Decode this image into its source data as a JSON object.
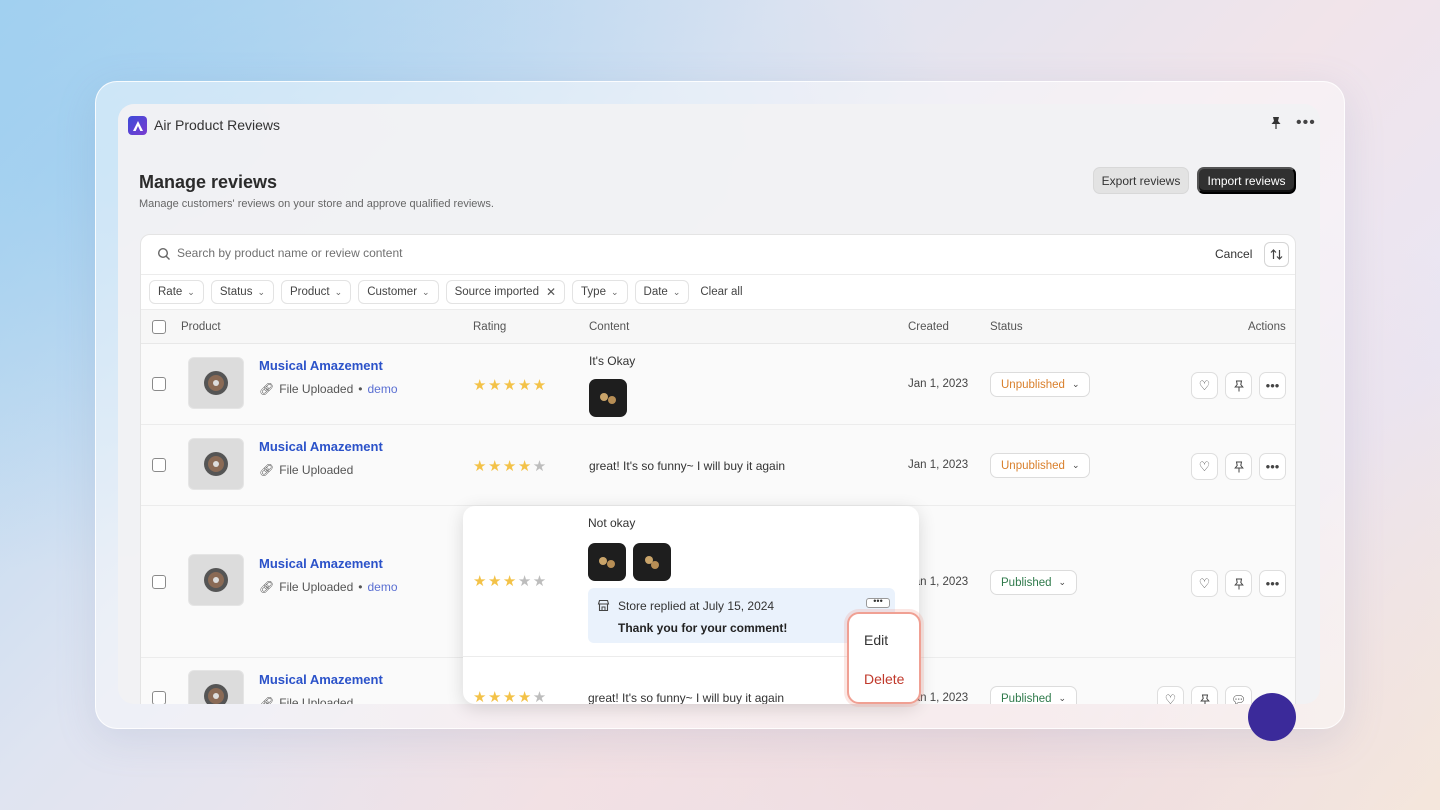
{
  "app": {
    "title": "Air Product Reviews"
  },
  "header": {
    "title": "Manage reviews",
    "subtitle": "Manage customers' reviews on your store and approve qualified reviews.",
    "export_label": "Export reviews",
    "import_label": "Import reviews"
  },
  "search": {
    "placeholder": "Search by product name or review content",
    "cancel_label": "Cancel"
  },
  "filters": {
    "rate": "Rate",
    "status": "Status",
    "product": "Product",
    "customer": "Customer",
    "source": "Source imported",
    "type": "Type",
    "date": "Date",
    "clear_all": "Clear all"
  },
  "columns": {
    "product": "Product",
    "rating": "Rating",
    "content": "Content",
    "created": "Created",
    "status": "Status",
    "actions": "Actions"
  },
  "rows": [
    {
      "product": "Musical Amazement",
      "file": "File Uploaded",
      "bullet": "•",
      "tag": "demo",
      "rating": 5,
      "content": "It's Okay",
      "created": "Jan 1, 2023",
      "status": "Unpublished"
    },
    {
      "product": "Musical Amazement",
      "file": "File Uploaded",
      "rating": 4,
      "content": "great! It's so funny~ I will buy it again",
      "created": "Jan 1, 2023",
      "status": "Unpublished"
    },
    {
      "product": "Musical Amazement",
      "file": "File Uploaded",
      "bullet": "•",
      "tag": "demo",
      "rating": 3,
      "content": "Not okay",
      "created": "Jan 1, 2023",
      "status": "Published",
      "reply": {
        "header": "Store replied at July 15, 2024",
        "body": "Thank you for your comment!"
      }
    },
    {
      "product": "Musical Amazement",
      "file": "File Uploaded",
      "rating": 4,
      "content": "great! It's so funny~ I will buy it again",
      "created": "Jan 1, 2023",
      "status": "Published"
    }
  ],
  "context_menu": {
    "edit": "Edit",
    "delete": "Delete"
  },
  "colors": {
    "accent": "#303030",
    "link": "#2b52c9",
    "unpublished": "#d97f2b",
    "published": "#2f7a4b",
    "star": "#f3c248",
    "delete": "#c0392b",
    "menu_highlight": "#f0a093"
  }
}
